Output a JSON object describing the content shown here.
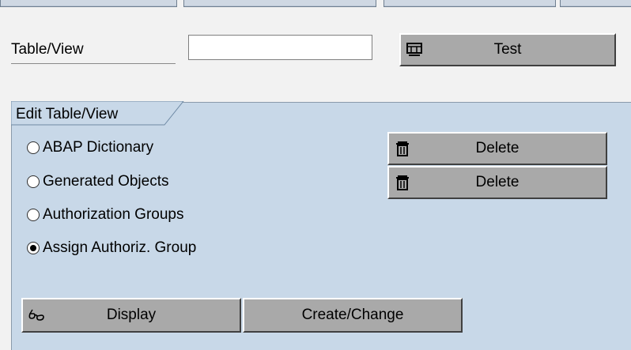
{
  "table_view": {
    "label": "Table/View",
    "value": "",
    "test_button": "Test"
  },
  "edit_group": {
    "title": "Edit Table/View",
    "options": [
      {
        "label": "ABAP Dictionary",
        "selected": false
      },
      {
        "label": "Generated Objects",
        "selected": false
      },
      {
        "label": "Authorization Groups",
        "selected": false
      },
      {
        "label": "Assign Authoriz. Group",
        "selected": true
      }
    ],
    "delete_button_1": "Delete",
    "delete_button_2": "Delete",
    "display_button": "Display",
    "create_change_button": "Create/Change"
  },
  "colors": {
    "frame_bg": "#c8d8e8",
    "button_face": "#a9a9a9"
  },
  "icons": {
    "test": "test-screen-icon",
    "delete": "trash-icon",
    "display": "glasses-icon"
  }
}
